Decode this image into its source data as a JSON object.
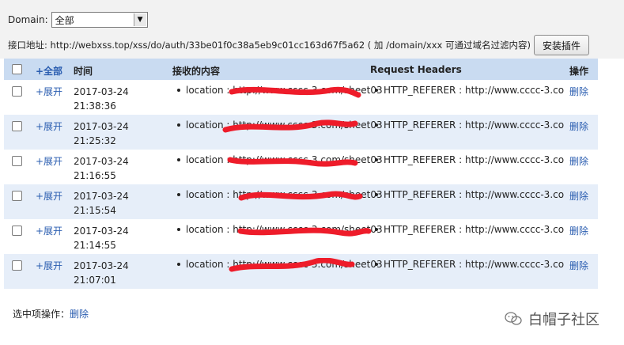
{
  "top": {
    "domain_label": "Domain:",
    "domain_value": "全部",
    "api_text": "接口地址: http://webxss.top/xss/do/auth/33be01f0c38a5eb9c01cc163d67f5a62 ( 加 /domain/xxx 可通过域名过滤内容)",
    "install_label": "安装插件"
  },
  "table": {
    "headers": {
      "expand_all": "+全部",
      "time": "时间",
      "content": "接收的内容",
      "request_headers": "Request Headers",
      "op": "操作"
    },
    "rows": [
      {
        "expand": "+展开",
        "date": "2017-03-24",
        "time": "21:38:36",
        "content": "location : http://www.cccc-3.com/sheet03",
        "header": "HTTP_REFERER : http://www.cccc-3.co",
        "op": "删除"
      },
      {
        "expand": "+展开",
        "date": "2017-03-24",
        "time": "21:25:32",
        "content": "location : http://www.cccc-3.com/sheet03",
        "header": "HTTP_REFERER : http://www.cccc-3.co",
        "op": "删除"
      },
      {
        "expand": "+展开",
        "date": "2017-03-24",
        "time": "21:16:55",
        "content": "location : http://www.cccc-3.com/sheet03",
        "header": "HTTP_REFERER : http://www.cccc-3.co",
        "op": "删除"
      },
      {
        "expand": "+展开",
        "date": "2017-03-24",
        "time": "21:15:54",
        "content": "location : http://www.cccc-3.com/sheet03",
        "header": "HTTP_REFERER : http://www.cccc-3.co",
        "op": "删除"
      },
      {
        "expand": "+展开",
        "date": "2017-03-24",
        "time": "21:14:55",
        "content": "location : http://www.cccc-3.com/sheet03",
        "header": "HTTP_REFERER : http://www.cccc-3.co",
        "op": "删除"
      },
      {
        "expand": "+展开",
        "date": "2017-03-24",
        "time": "21:07:01",
        "content": "location : http://www.cccc-3.com/sheet03",
        "header": "HTTP_REFERER : http://www.cccc-3.co",
        "op": "删除"
      }
    ]
  },
  "footer": {
    "label": "选中项操作：",
    "delete": "删除"
  },
  "watermark": {
    "text": "白帽子社区",
    "icon": "wechat-icon"
  },
  "colors": {
    "header_bg": "#c9dbf1",
    "row_alt_bg": "#e6eef9",
    "link": "#2a5db0",
    "redaction": "#ee1c2a"
  }
}
